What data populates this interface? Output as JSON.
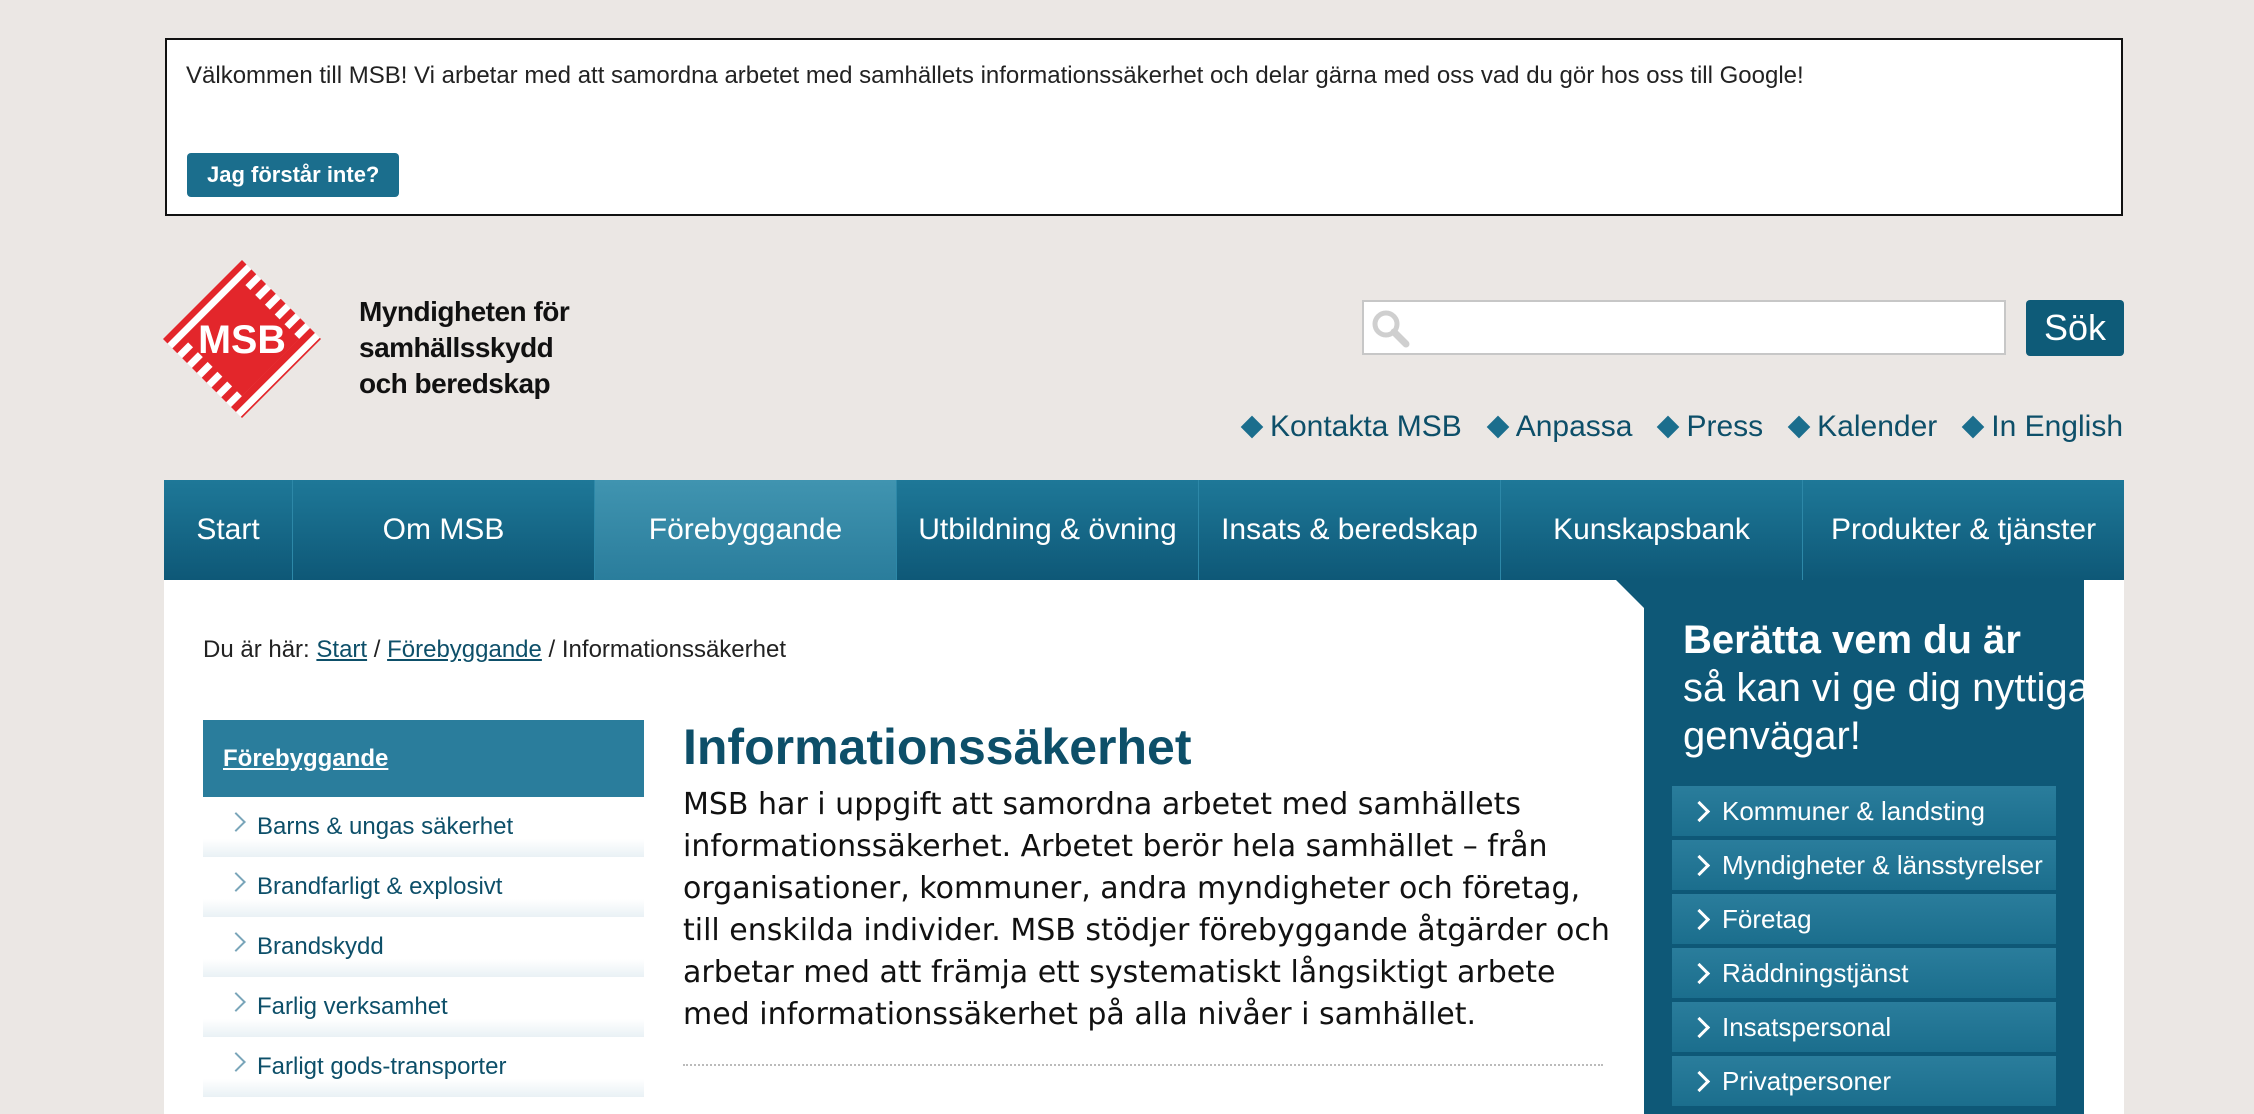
{
  "cookie": {
    "text": "Välkommen till MSB! Vi arbetar med att samordna arbetet med samhällets informationssäkerhet och delar gärna med oss vad du gör hos oss till Google!",
    "button": "Jag förstår inte?"
  },
  "logo": {
    "mark": "MSB",
    "title_lines": [
      "Myndigheten för",
      "samhällsskydd",
      "och beredskap"
    ]
  },
  "search": {
    "placeholder": "",
    "button": "Sök"
  },
  "util_links": [
    "Kontakta MSB",
    "Anpassa",
    "Press",
    "Kalender",
    "In English"
  ],
  "mainnav": [
    {
      "label": "Start",
      "active": false
    },
    {
      "label": "Om MSB",
      "active": false
    },
    {
      "label": "Förebyggande",
      "active": true
    },
    {
      "label": "Utbildning & övning",
      "active": false
    },
    {
      "label": "Insats & beredskap",
      "active": false
    },
    {
      "label": "Kunskapsbank",
      "active": false
    },
    {
      "label": "Produkter & tjänster",
      "active": false
    }
  ],
  "breadcrumb": {
    "prefix": "Du är här:",
    "items": [
      "Start",
      "Förebyggande"
    ],
    "current": "Informationssäkerhet"
  },
  "subnav": {
    "heading": "Förebyggande",
    "items": [
      "Barns & ungas säkerhet",
      "Brandfarligt & explosivt",
      "Brandskydd",
      "Farlig verksamhet",
      "Farligt gods-transporter"
    ]
  },
  "main": {
    "title": "Informationssäkerhet",
    "intro": "MSB har i uppgift att samordna arbetet med samhällets informationssäkerhet. Arbetet berör hela samhället – från organisationer, kommuner, andra myndigheter och företag, till enskilda individer. MSB stödjer förebyggande åtgärder och arbetar med att främja ett systematiskt långsiktigt arbete med informationssäkerhet på alla nivåer i samhället."
  },
  "side": {
    "heading_bold": "Berätta vem du är",
    "heading_rest": "så kan vi ge dig nyttiga genvägar!",
    "items": [
      "Kommuner & landsting",
      "Myndigheter & länsstyrelser",
      "Företag",
      "Räddningstjänst",
      "Insatspersonal",
      "Privatpersoner"
    ]
  },
  "colors": {
    "brand_red": "#e3262b",
    "brand_blue": "#0e5877",
    "accent_blue": "#2a7d9c"
  }
}
